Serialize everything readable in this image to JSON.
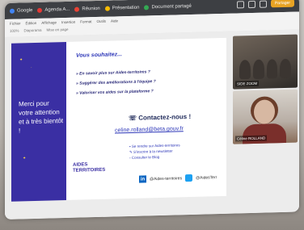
{
  "browser": {
    "tabs": [
      "Google",
      "Agenda A...",
      "Réunion",
      "Présentation",
      "Document partagé"
    ],
    "button": "Partager"
  },
  "doc": {
    "menu": [
      "Fichier",
      "Édition",
      "Affichage",
      "Insertion",
      "Format",
      "Outils",
      "Aide"
    ],
    "tools": [
      "100%",
      "Diaporama",
      "Mise en page"
    ]
  },
  "slide": {
    "left_text": "Merci pour votre attention et à très bientôt !",
    "title": "Vous souhaitez...",
    "bullets": [
      "» En savoir plus sur Aides-territoires ?",
      "» Suggérer des améliorations à l'équipe ?",
      "» Valoriser vos aides sur la plateforme ?"
    ],
    "contact": "Contactez-nous !",
    "email": "celine.rolland@beta.gouv.fr",
    "links": [
      "Se rendre sur Aides-territoires",
      "S'inscrire à la newsletter",
      "Consulter le Blog"
    ],
    "logo_line1": "AIDES",
    "logo_line2": "TERRITOIRES",
    "linkedin": "@Aides-territoires",
    "twitter": "@AidesTerr"
  },
  "video": {
    "top_label": "SIDE ZOOM",
    "bottom_label": "Céline ROLLAND"
  },
  "colors": {
    "accent": "#3a2fa3",
    "link": "#2c36b8",
    "button": "#e8a324"
  }
}
